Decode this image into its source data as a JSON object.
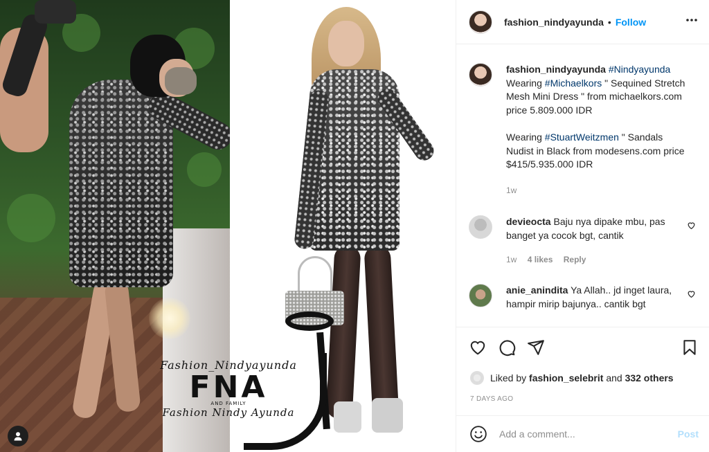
{
  "header": {
    "username": "fashion_nindyayunda",
    "separator": "•",
    "follow_label": "Follow",
    "more_icon": "more-horizontal-icon"
  },
  "caption": {
    "username": "fashion_nindyayunda",
    "tag1": "#Nindyayunda",
    "line1_prefix": "Wearing",
    "tag2": "#Michaelkors",
    "line1_rest": "\" Sequined Stretch Mesh Mini Dress \" from michaelkors.com price 5.809.000 IDR",
    "line2_prefix": "Wearing",
    "tag3": "#StuartWeitzmen",
    "line2_rest": "\" Sandals Nudist in Black from modesens.com price $415/5.935.000 IDR",
    "age": "1w"
  },
  "comments": [
    {
      "username": "devieocta",
      "text": "Baju nya dipake mbu, pas banget ya cocok bgt, cantik",
      "age": "1w",
      "likes": "4 likes",
      "reply_label": "Reply"
    },
    {
      "username": "anie_anindita",
      "text": "Ya Allah.. jd inget laura, hampir mirip bajunya.. cantik bgt"
    }
  ],
  "likes": {
    "prefix": "Liked by",
    "user": "fashion_selebrit",
    "and": "and",
    "others": "332 others"
  },
  "post_age": "7 DAYS AGO",
  "add_comment": {
    "placeholder": "Add a comment...",
    "post_label": "Post"
  },
  "watermark": {
    "script_top": "Fashion_Nindyayunda",
    "logo": "FNA",
    "sub": "AND FAMILY",
    "script_bottom": "Fashion Nindy Ayunda"
  },
  "colors": {
    "accent": "#0095f6",
    "hashtag": "#00376b",
    "muted": "#8e8e8e",
    "post_disabled": "#b2dffc",
    "divider": "#efefef"
  }
}
